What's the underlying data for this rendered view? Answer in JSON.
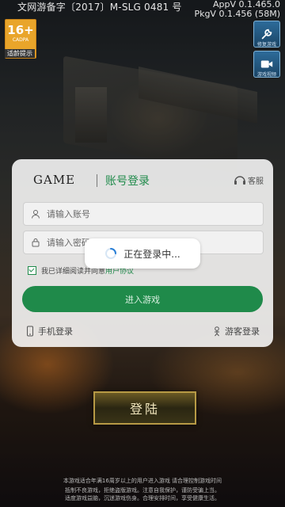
{
  "header": {
    "license": "文网游备字〔2017〕M-SLG 0481 号",
    "app_version": "AppV 0.1.465.0",
    "pkg_version": "PkgV 0.1.456 (58M)"
  },
  "age_rating": {
    "label": "16+",
    "sub": "CADPA",
    "tip": "适龄提示"
  },
  "side_buttons": [
    {
      "caption": "修复游戏",
      "icon": "repair-icon"
    },
    {
      "caption": "游戏视频",
      "icon": "video-icon"
    }
  ],
  "dialog": {
    "brand": "GAME",
    "title": "账号登录",
    "customer_service": "客服",
    "account_placeholder": "请输入账号",
    "password_placeholder": "请输入密码",
    "agree_prefix": "我已详细阅读并同意",
    "agree_link": "用户协议",
    "enter_label": "进入游戏",
    "phone_login": "手机登录",
    "guest_login": "游客登录"
  },
  "toast": {
    "text": "正在登录中..."
  },
  "login_button": "登陆",
  "footer": {
    "line1": "本游戏适合年满16周岁以上的用户进入游戏 请合理控制游戏时间",
    "line2": "抵制不良游戏，拒绝盗版游戏。注意自我保护，谨防受骗上当。",
    "line3": "适度游戏益脑，沉迷游戏伤身。合理安排时间，享受健康生活。"
  },
  "colors": {
    "accent": "#1f8a4a",
    "badge": "#e9a52a",
    "gold": "#b79a45"
  }
}
